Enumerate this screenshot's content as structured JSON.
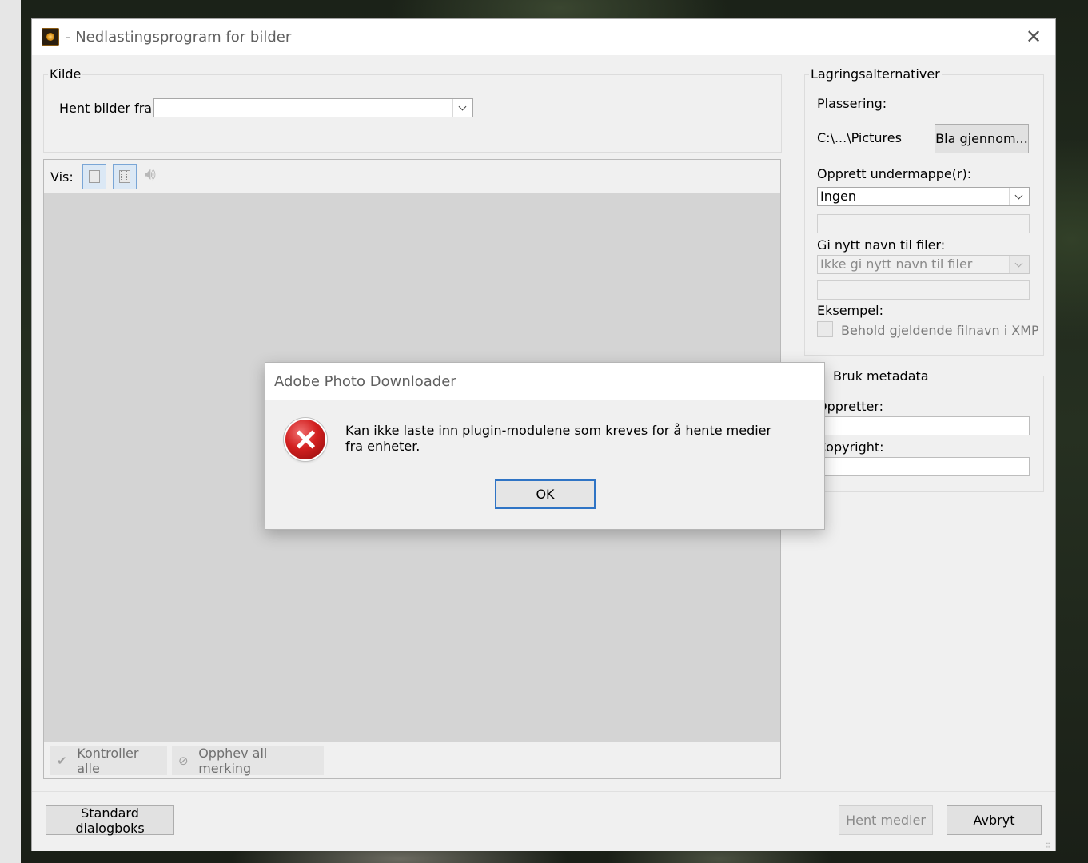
{
  "window": {
    "title": "- Nedlastingsprogram for bilder"
  },
  "source": {
    "group_label": "Kilde",
    "get_from_label": "Hent bilder fra:",
    "get_from_value": ""
  },
  "view": {
    "label": "Vis:"
  },
  "thumb_actions": {
    "check_all": "Kontroller alle",
    "uncheck_all": "Opphev all merking"
  },
  "storage": {
    "group_label": "Lagringsalternativer",
    "location_label": "Plassering:",
    "location_value": "C:\\...\\Pictures",
    "browse_label": "Bla gjennom...",
    "subfolder_label": "Opprett undermappe(r):",
    "subfolder_value": "Ingen",
    "rename_label": "Gi nytt navn til filer:",
    "rename_value": "Ikke gi nytt navn til filer",
    "example_label": "Eksempel:",
    "keep_filename_label": "Behold gjeldende filnavn i XMP"
  },
  "metadata": {
    "group_label": "Bruk metadata",
    "creator_label": "Oppretter:",
    "copyright_label": "Copyright:"
  },
  "footer": {
    "standard_dialog": "Standard dialogboks",
    "get_media": "Hent medier",
    "cancel": "Avbryt"
  },
  "dialog": {
    "title": "Adobe Photo Downloader",
    "message": "Kan ikke laste inn plugin-modulene som kreves for å hente medier fra enheter.",
    "ok_label": "OK"
  }
}
